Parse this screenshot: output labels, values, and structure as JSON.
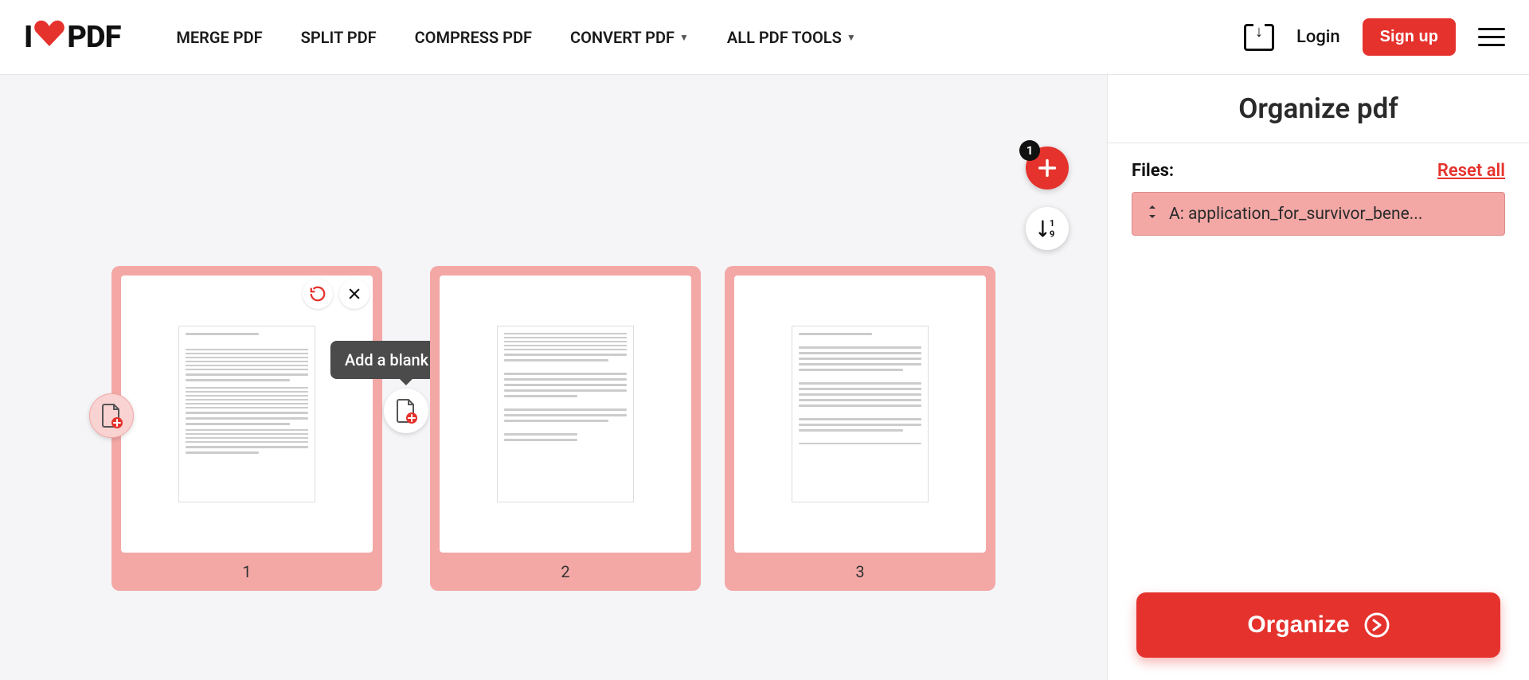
{
  "brand": {
    "left": "I",
    "right": "PDF"
  },
  "nav": {
    "merge": "MERGE PDF",
    "split": "SPLIT PDF",
    "compress": "COMPRESS PDF",
    "convert": "CONVERT PDF",
    "all": "ALL PDF TOOLS"
  },
  "header": {
    "login": "Login",
    "signup": "Sign up"
  },
  "fab": {
    "badge": "1",
    "sort_label": "1\n9"
  },
  "tooltip": {
    "add_blank": "Add a blank page"
  },
  "pages": {
    "p1": "1",
    "p2": "2",
    "p3": "3"
  },
  "sidebar": {
    "title": "Organize pdf",
    "files_label": "Files:",
    "reset": "Reset all",
    "file_a": "A: application_for_survivor_bene...",
    "organize": "Organize"
  },
  "colors": {
    "accent": "#e5322d",
    "card": "#f3a8a6"
  }
}
